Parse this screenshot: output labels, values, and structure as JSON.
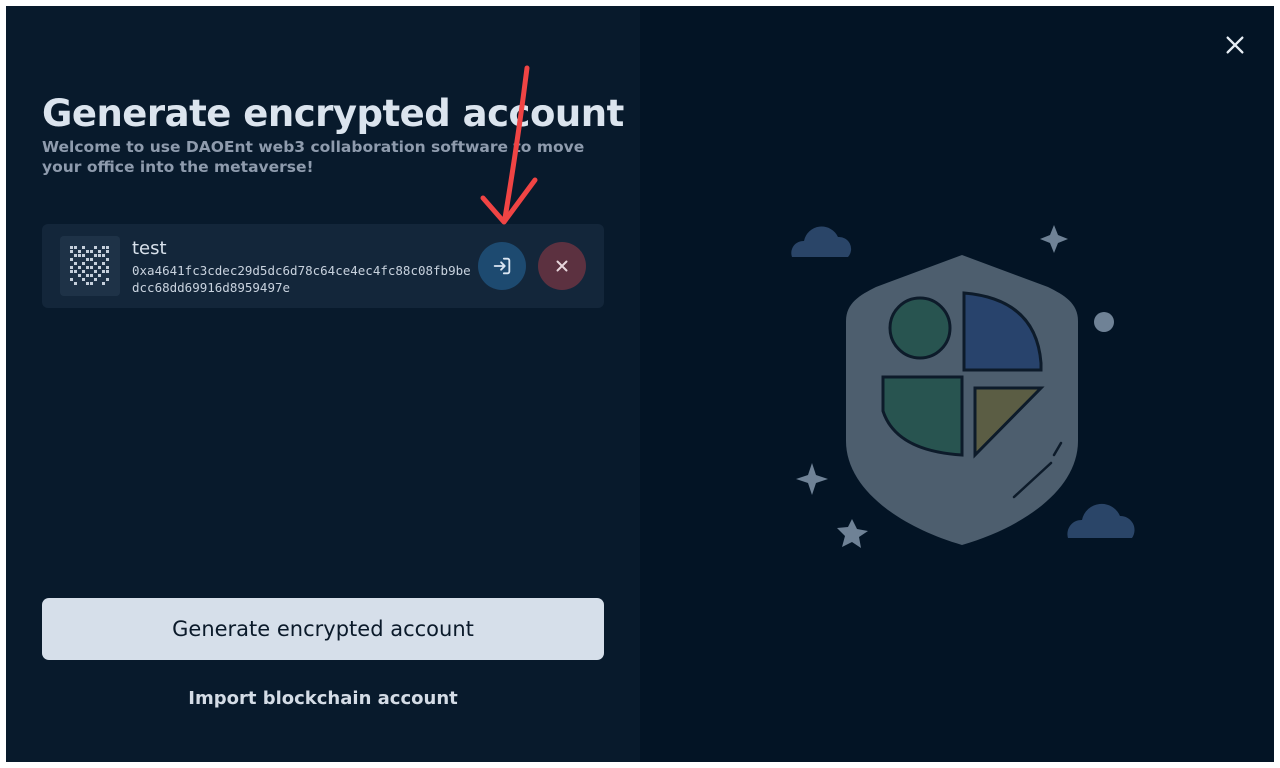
{
  "header": {
    "title": "Generate encrypted account",
    "subtitle": "Welcome to use DAOEnt web3 collaboration software to move your office into the metaverse!"
  },
  "accounts": [
    {
      "name": "test",
      "address": "0xa4641fc3cdec29d5dc6d78c64ce4ec4fc88c08fb9bedcc68dd69916d8959497e",
      "login_icon": "login-icon",
      "remove_icon": "close-icon"
    }
  ],
  "actions": {
    "generate_label": "Generate encrypted account",
    "import_label": "Import blockchain account"
  },
  "window": {
    "close_icon": "close-icon"
  },
  "illustration": {
    "name": "security-shield-illustration"
  },
  "colors": {
    "background": "#081a2c",
    "card": "#13263a",
    "login_button": "#1d4a70",
    "remove_button": "#5c3140",
    "primary_button": "#d6dfea",
    "annotation_arrow": "#f04444"
  }
}
